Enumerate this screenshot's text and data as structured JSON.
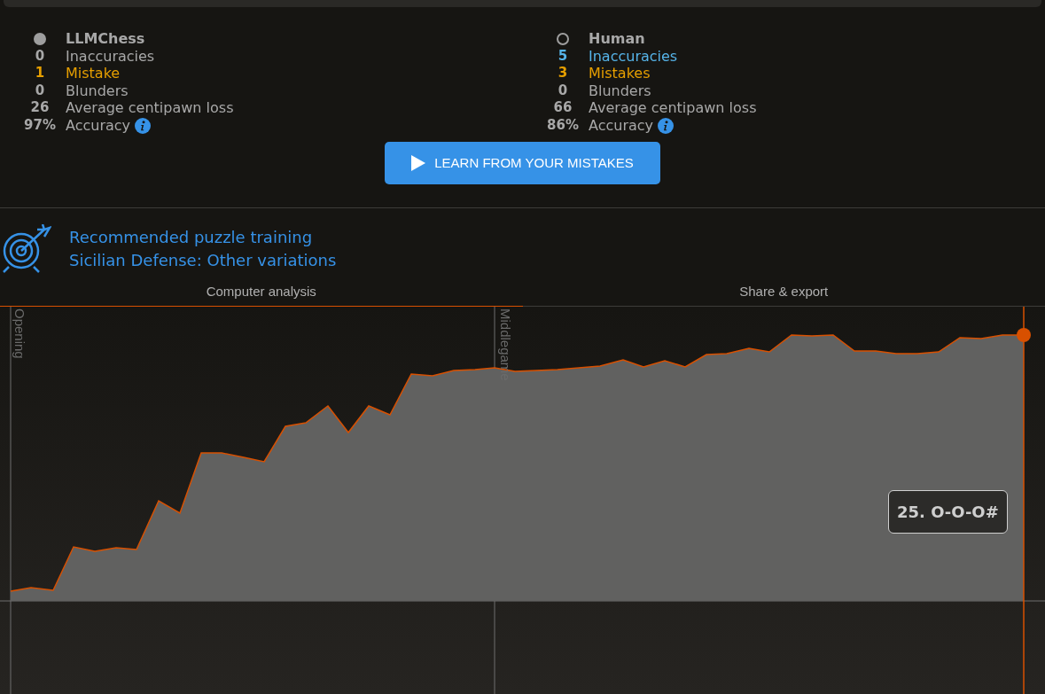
{
  "players": [
    {
      "name": "LLMChess",
      "kind": "filled",
      "stats": [
        {
          "count": "0",
          "label": "Inaccuracies",
          "color": "#a8a8a8",
          "info": false
        },
        {
          "count": "1",
          "label": "Mistake",
          "color": "#e69f00",
          "info": false
        },
        {
          "count": "0",
          "label": "Blunders",
          "color": "#a8a8a8",
          "info": false
        },
        {
          "count": "26",
          "label": "Average centipawn loss",
          "color": "#a8a8a8",
          "info": false
        },
        {
          "count": "97%",
          "label": "Accuracy",
          "color": "#a8a8a8",
          "info": true
        }
      ]
    },
    {
      "name": "Human",
      "kind": "hollow",
      "stats": [
        {
          "count": "5",
          "label": "Inaccuracies",
          "color": "#56b4e9",
          "info": false
        },
        {
          "count": "3",
          "label": "Mistakes",
          "color": "#e69f00",
          "info": false
        },
        {
          "count": "0",
          "label": "Blunders",
          "color": "#a8a8a8",
          "info": false
        },
        {
          "count": "66",
          "label": "Average centipawn loss",
          "color": "#a8a8a8",
          "info": false
        },
        {
          "count": "86%",
          "label": "Accuracy",
          "color": "#a8a8a8",
          "info": true
        }
      ]
    }
  ],
  "learn_button": {
    "label": "LEARN FROM YOUR MISTAKES"
  },
  "puzzle": {
    "title": "Recommended puzzle training",
    "theme": "Sicilian Defense: Other variations"
  },
  "tabs": [
    {
      "label": "Computer analysis",
      "selected": true
    },
    {
      "label": "Share & export",
      "selected": false
    }
  ],
  "chart": {
    "phases": [
      "Opening",
      "Middlegame"
    ],
    "tooltip": "25. O-O-O#"
  }
}
